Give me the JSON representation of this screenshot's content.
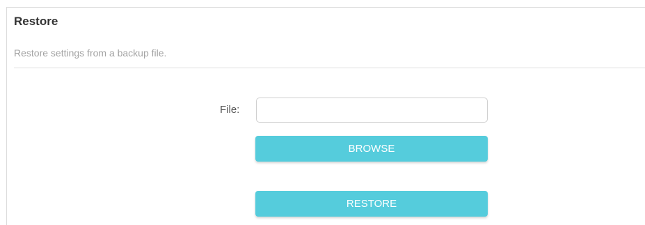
{
  "section": {
    "title": "Restore",
    "description": "Restore settings from a backup file."
  },
  "form": {
    "file_label": "File:",
    "file_value": "",
    "browse_label": "BROWSE",
    "restore_label": "RESTORE"
  },
  "colors": {
    "button_bg": "#55ccdc",
    "button_text": "#ffffff",
    "title_text": "#333333",
    "description_text": "#a3a3a3"
  }
}
